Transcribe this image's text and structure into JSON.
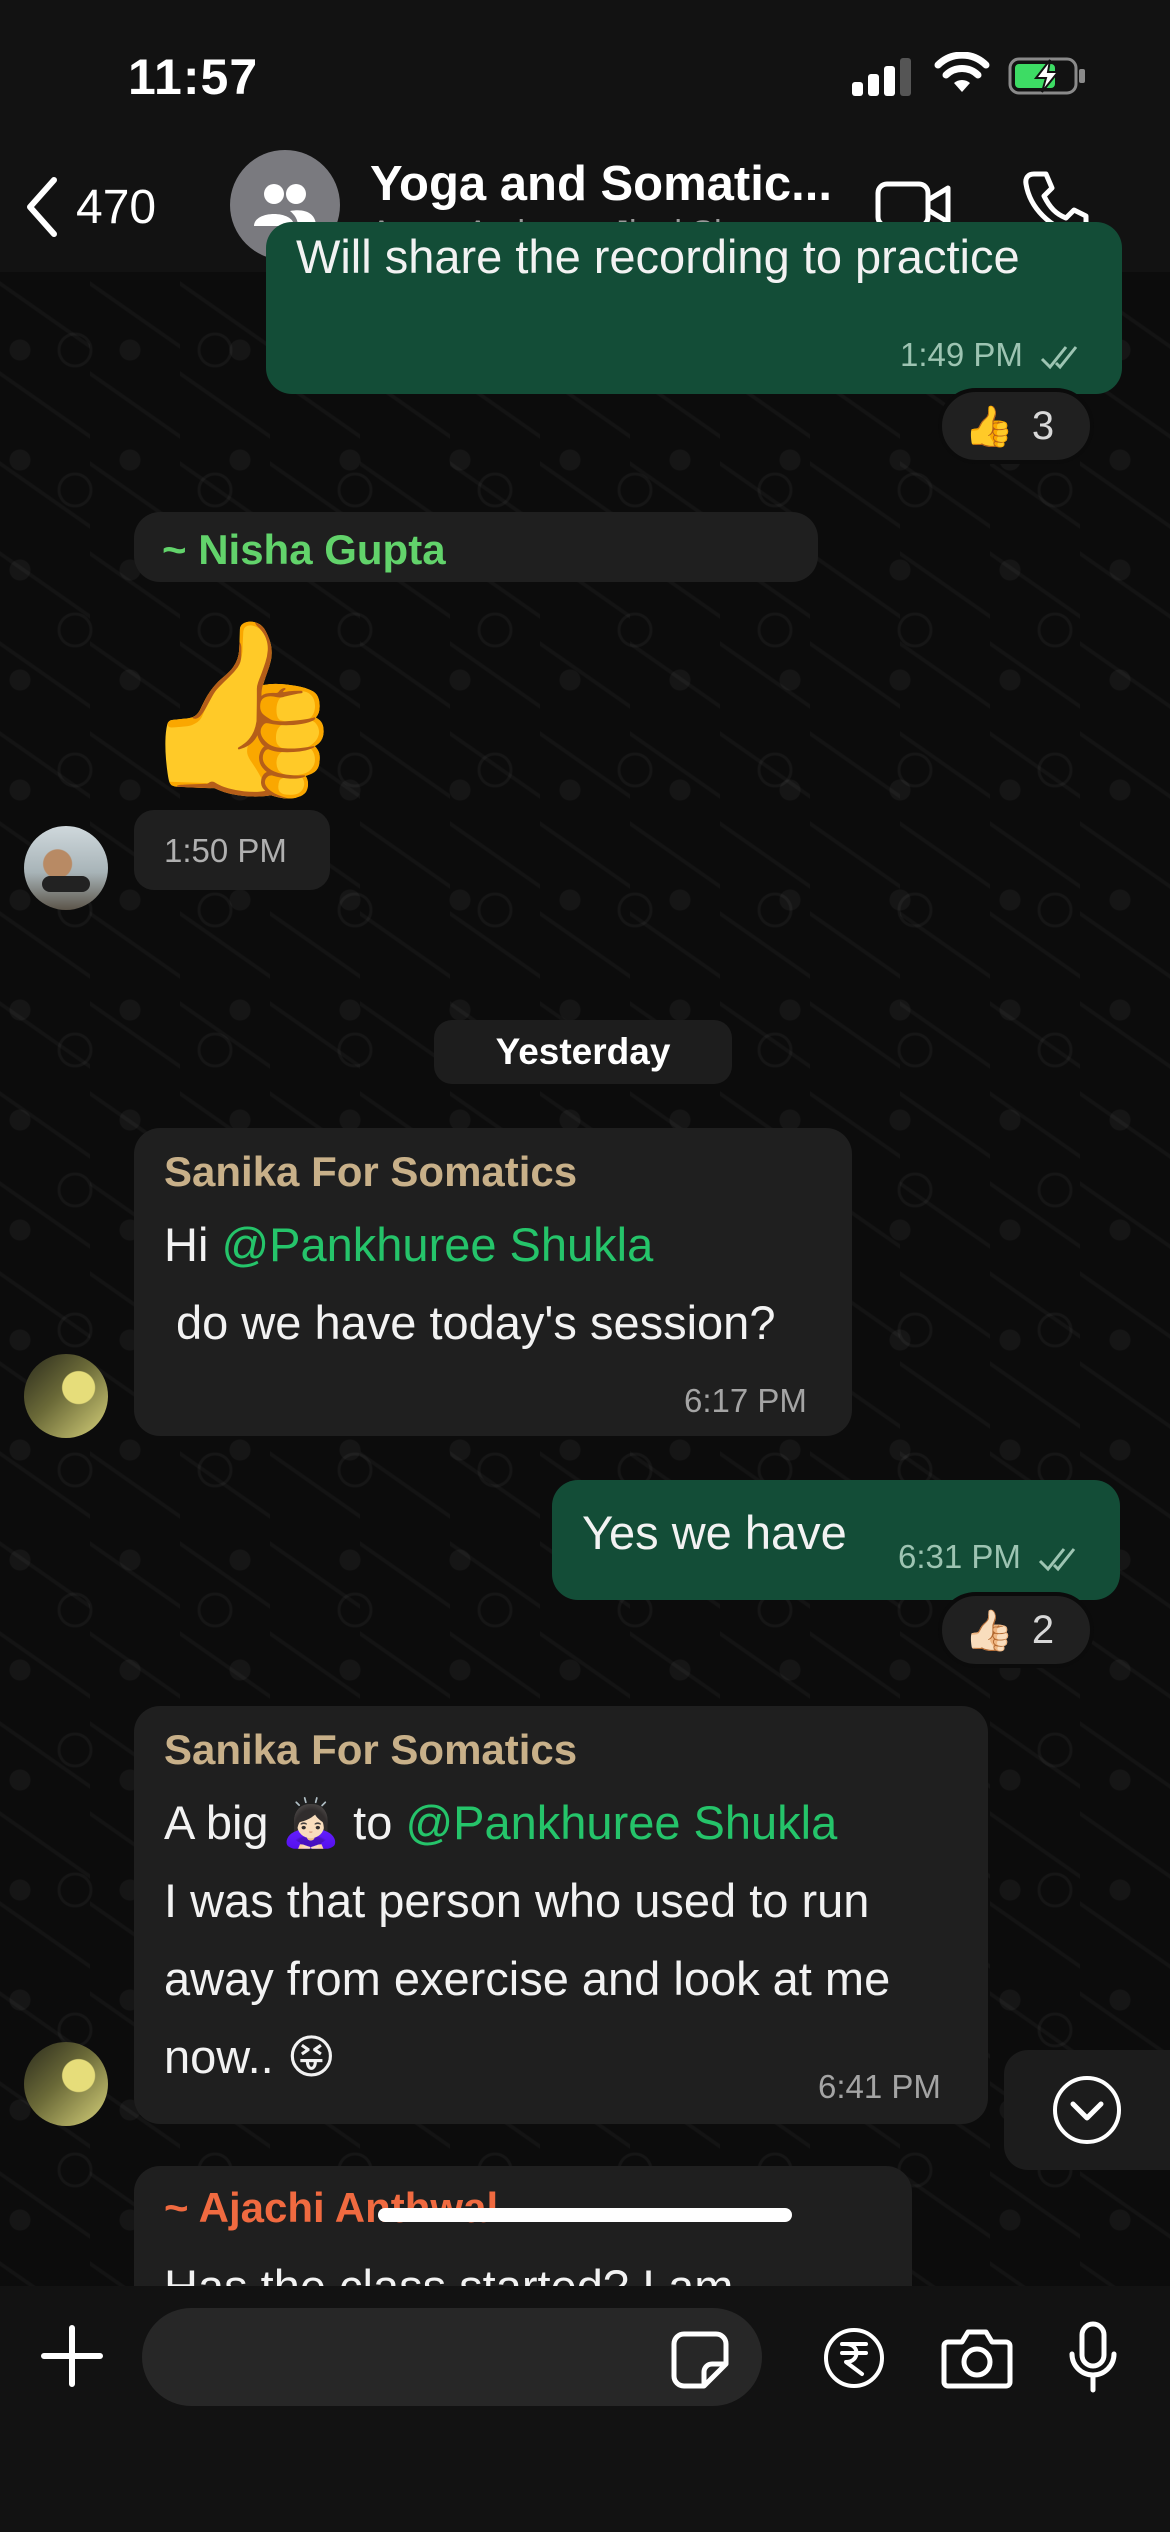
{
  "status_bar": {
    "time": "11:57"
  },
  "header": {
    "back_count": "470",
    "title": "Yoga and Somatic...",
    "subtitle": "Appu, Archana, Jinal Shru..."
  },
  "messages": {
    "m1": {
      "text": "Will share the recording to practice",
      "time": "1:49 PM",
      "reaction_emoji": "👍",
      "reaction_count": "3"
    },
    "m2": {
      "sender": "~ Nisha Gupta",
      "emoji": "👍",
      "time": "1:50 PM"
    },
    "date_separator": "Yesterday",
    "m3": {
      "sender": "Sanika For Somatics",
      "greeting": "Hi ",
      "mention": "@Pankhuree Shukla",
      "line2": "do we have today's session?",
      "time": "6:17 PM"
    },
    "m4": {
      "text": "Yes we have",
      "time": "6:31 PM",
      "reaction_emoji": "👍🏻",
      "reaction_count": "2"
    },
    "m5": {
      "sender": "Sanika For Somatics",
      "line1_pre": "A big ",
      "line1_emoji": "🙇🏻‍♀️",
      "line1_mid": " to ",
      "mention": "@Pankhuree Shukla",
      "line2": "I was that person who used to run",
      "line3": "away from exercise and look at me",
      "line4": "now.. ",
      "line4_emoji": "😝",
      "time": "6:41 PM"
    },
    "m6": {
      "sender": "~ Ajachi Anthwal",
      "text": "Has the class started? I am"
    }
  },
  "composer": {
    "placeholder": ""
  },
  "colors": {
    "outgoing_bubble": "#134d37",
    "incoming_bubble": "#1f1f1f",
    "mention": "#25c46a",
    "sender_nisha": "#62d36b",
    "sender_sanika": "#c8b089",
    "sender_ajachi": "#f06a40"
  }
}
